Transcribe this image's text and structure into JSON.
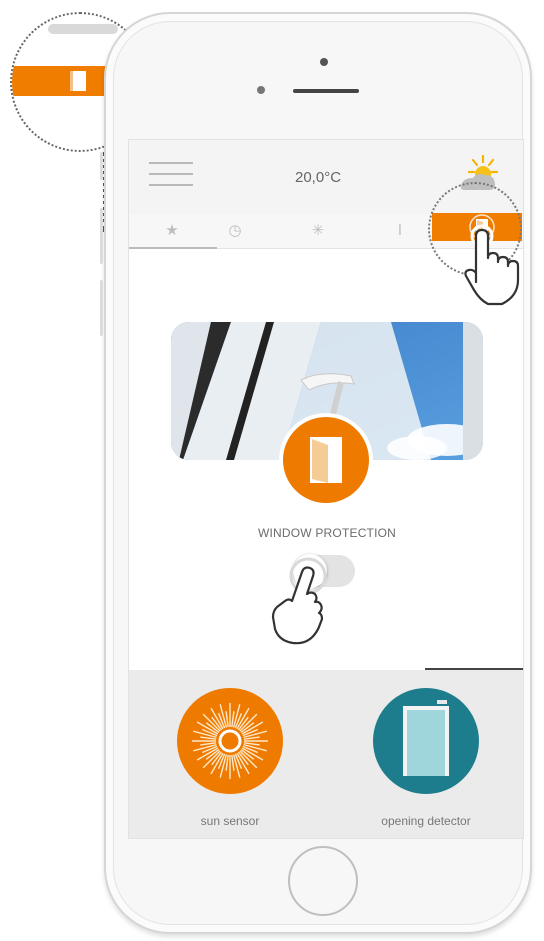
{
  "header": {
    "temperature": "20,0°C",
    "menu_icon": "hamburger-menu-icon",
    "weather_icon": "sun-cloud-icon"
  },
  "tabs": [
    {
      "icon": "star-icon",
      "glyph": "★"
    },
    {
      "icon": "clock-icon",
      "glyph": "◷"
    },
    {
      "icon": "sun-icon",
      "glyph": "✳"
    },
    {
      "icon": "temperature-icon",
      "glyph": "ǀ"
    },
    {
      "icon": "window-icon",
      "glyph": ""
    }
  ],
  "feature": {
    "label": "WINDOW PROTECTION",
    "icon": "window-protection-icon",
    "toggle_on": false
  },
  "devices": [
    {
      "label": "sun sensor",
      "icon": "sun-sensor-icon",
      "color": "#ee7a00"
    },
    {
      "label": "opening detector",
      "icon": "opening-detector-icon",
      "color": "#1e7d8c"
    }
  ],
  "colors": {
    "accent": "#f07c00",
    "teal": "#1e7d8c"
  }
}
